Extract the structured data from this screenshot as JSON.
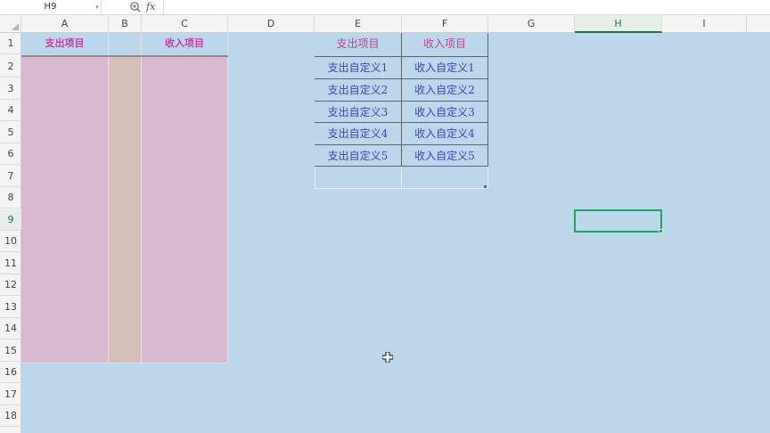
{
  "formula_bar": {
    "name_box": "H9",
    "fx_label": "fx",
    "formula": ""
  },
  "columns": [
    "A",
    "B",
    "C",
    "D",
    "E",
    "F",
    "G",
    "H",
    "I"
  ],
  "rows": [
    "1",
    "2",
    "3",
    "4",
    "5",
    "6",
    "7",
    "8",
    "9",
    "10",
    "11",
    "12",
    "13",
    "14",
    "15",
    "16",
    "17",
    "18"
  ],
  "selected_cell": "H9",
  "left_table": {
    "expense_header": "支出项目",
    "income_header": "收入项目"
  },
  "right_table": {
    "headers": [
      "支出项目",
      "收入项目"
    ],
    "rows": [
      [
        "支出自定义1",
        "收入自定义1"
      ],
      [
        "支出自定义2",
        "收入自定义2"
      ],
      [
        "支出自定义3",
        "收入自定义3"
      ],
      [
        "支出自定义4",
        "收入自定义4"
      ],
      [
        "支出自定义5",
        "收入自定义5"
      ]
    ]
  },
  "colors": {
    "sheet_bg": "#bcd7ec",
    "pink_fill": "#d9b9cf",
    "tan_fill": "#d4c0b8",
    "header_text": "#cc3c9c",
    "body_text": "#3b45c0",
    "selection": "#21a366"
  }
}
